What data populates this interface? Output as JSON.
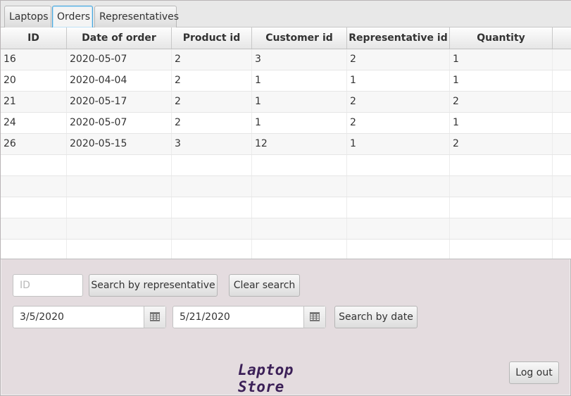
{
  "tabs": [
    {
      "label": "Laptops",
      "active": false
    },
    {
      "label": "Orders",
      "active": true
    },
    {
      "label": "Representatives",
      "active": false
    }
  ],
  "table": {
    "columns": [
      "ID",
      "Date of order",
      "Product id",
      "Customer id",
      "Representative id",
      "Quantity"
    ],
    "rows": [
      [
        "16",
        "2020-05-07",
        "2",
        "3",
        "2",
        "1"
      ],
      [
        "20",
        "2020-04-04",
        "2",
        "1",
        "1",
        "1"
      ],
      [
        "21",
        "2020-05-17",
        "2",
        "1",
        "2",
        "2"
      ],
      [
        "24",
        "2020-05-07",
        "2",
        "1",
        "2",
        "1"
      ],
      [
        "26",
        "2020-05-15",
        "3",
        "12",
        "1",
        "2"
      ]
    ]
  },
  "search": {
    "id_placeholder": "ID",
    "by_rep_label": "Search by representative",
    "clear_label": "Clear search",
    "date_from": "3/5/2020",
    "date_to": "5/21/2020",
    "by_date_label": "Search by date"
  },
  "footer": {
    "brand": "Laptop Store",
    "logout_label": "Log out"
  },
  "icons": {
    "calendar": "calendar-icon"
  },
  "colors": {
    "background": "#e4dcdf",
    "brand_text": "#3b1f57",
    "active_tab_border": "#48a5db"
  }
}
